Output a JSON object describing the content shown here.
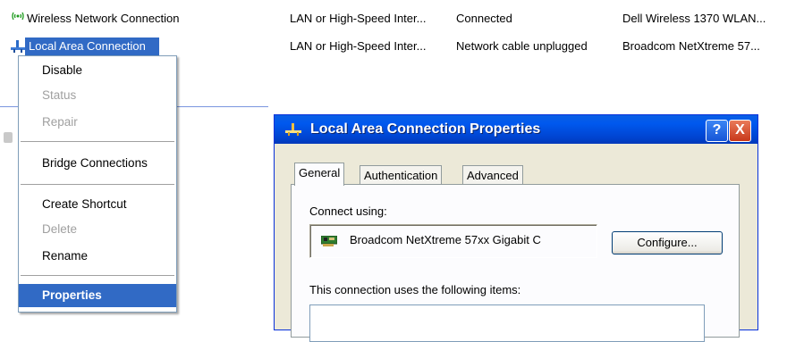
{
  "connections": [
    {
      "name": "Wireless Network Connection",
      "type": "LAN or High-Speed Inter...",
      "status": "Connected",
      "device": "Dell Wireless 1370 WLAN..."
    },
    {
      "name": "Local Area Connection",
      "type": "LAN or High-Speed Inter...",
      "status": "Network cable unplugged",
      "device": "Broadcom NetXtreme 57..."
    }
  ],
  "context_menu": {
    "items": [
      {
        "label": "Disable",
        "enabled": true
      },
      {
        "label": "Status",
        "enabled": false
      },
      {
        "label": "Repair",
        "enabled": false
      },
      {
        "label": "Bridge Connections",
        "enabled": true
      },
      {
        "label": "Create Shortcut",
        "enabled": true
      },
      {
        "label": "Delete",
        "enabled": false
      },
      {
        "label": "Rename",
        "enabled": true
      },
      {
        "label": "Properties",
        "enabled": true,
        "selected": true
      }
    ]
  },
  "dialog": {
    "title": "Local Area Connection Properties",
    "help_button": "?",
    "close_button": "X",
    "tabs": [
      {
        "label": "General",
        "active": true
      },
      {
        "label": "Authentication",
        "active": false
      },
      {
        "label": "Advanced",
        "active": false
      }
    ],
    "connect_using_label": "Connect using:",
    "adapter_name": "Broadcom NetXtreme 57xx Gigabit C",
    "configure_button": "Configure...",
    "items_label": "This connection uses the following items:"
  },
  "colors": {
    "selection": "#316ac5",
    "titlebar": "#0058ee",
    "close_button": "#e2451f",
    "dialog_face": "#ece9d8"
  }
}
